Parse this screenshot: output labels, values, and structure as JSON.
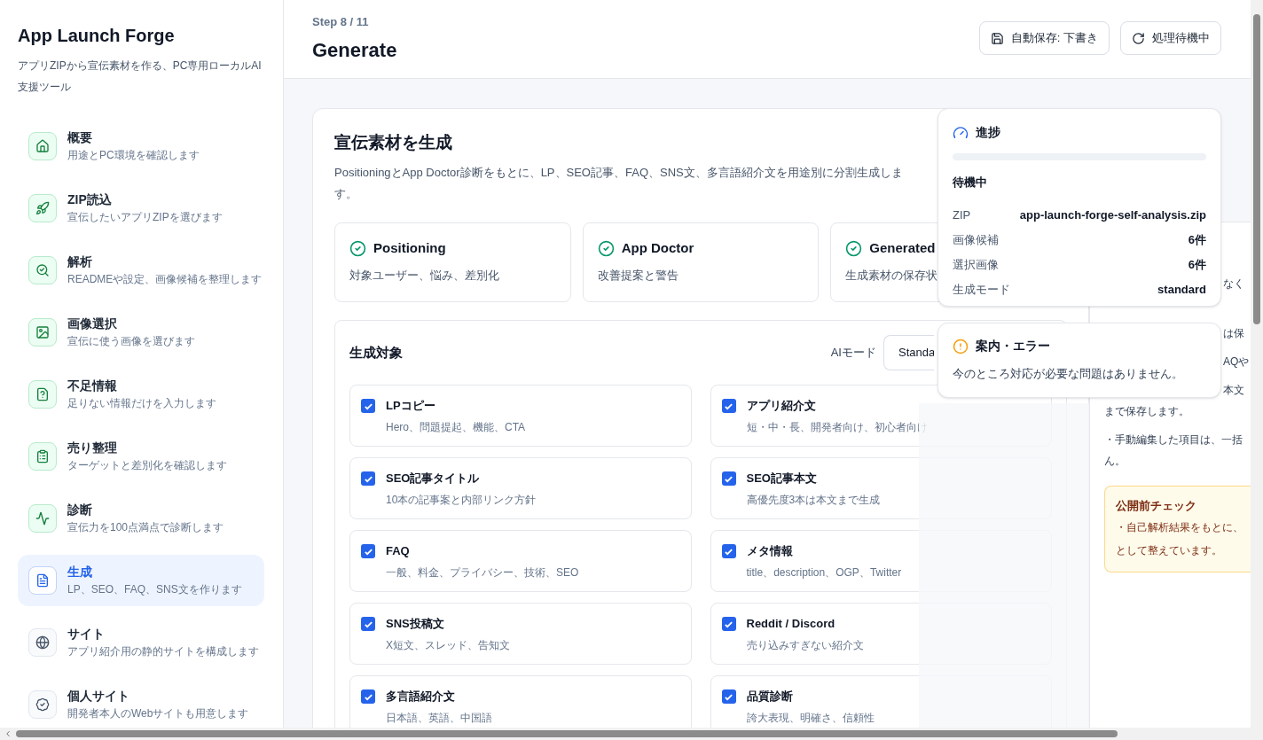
{
  "sidebar": {
    "title": "App Launch Forge",
    "subtitle": "アプリZIPから宣伝素材を作る、PC専用ローカルAI支援ツール",
    "items": [
      {
        "label": "概要",
        "description": "用途とPC環境を確認します",
        "completed": true,
        "selected": false
      },
      {
        "label": "ZIP読込",
        "description": "宣伝したいアプリZIPを選びます",
        "completed": true,
        "selected": false
      },
      {
        "label": "解析",
        "description": "READMEや設定、画像候補を整理します",
        "completed": true,
        "selected": false
      },
      {
        "label": "画像選択",
        "description": "宣伝に使う画像を選びます",
        "completed": true,
        "selected": false
      },
      {
        "label": "不足情報",
        "description": "足りない情報だけを入力します",
        "completed": true,
        "selected": false
      },
      {
        "label": "売り整理",
        "description": "ターゲットと差別化を確認します",
        "completed": true,
        "selected": false
      },
      {
        "label": "診断",
        "description": "宣伝力を100点満点で診断します",
        "completed": true,
        "selected": false
      },
      {
        "label": "生成",
        "description": "LP、SEO、FAQ、SNS文を作ります",
        "completed": false,
        "selected": true
      },
      {
        "label": "サイト",
        "description": "アプリ紹介用の静的サイトを構成します",
        "completed": false,
        "selected": false
      },
      {
        "label": "個人サイト",
        "description": "開発者本人のWebサイトも用意します",
        "completed": false,
        "selected": false
      }
    ]
  },
  "header": {
    "step": "Step 8 / 11",
    "title": "Generate",
    "buttons": [
      {
        "label": "自動保存: 下書き"
      },
      {
        "label": "処理待機中"
      }
    ]
  },
  "main": {
    "title": "宣伝素材を生成",
    "description": "PositioningとApp Doctor診断をもとに、LP、SEO記事、FAQ、SNS文、多言語紹介文を用途別に分割生成します。",
    "features": [
      {
        "title": "Positioning",
        "description": "対象ユーザー、悩み、差別化",
        "done": true
      },
      {
        "title": "App Doctor",
        "description": "改善提案と警告",
        "done": true
      },
      {
        "title": "Generated",
        "description": "生成素材の保存状",
        "done": true
      }
    ],
    "targets": {
      "title": "生成対象",
      "ai_mode_label": "AIモード",
      "ai_mode_value": "Standa",
      "items": [
        {
          "label": "LPコピー",
          "description": "Hero、問題提起、機能、CTA",
          "checked": true
        },
        {
          "label": "アプリ紹介文",
          "description": "短・中・長、開発者向け、初心者向け",
          "checked": true
        },
        {
          "label": "SEO記事タイトル",
          "description": "10本の記事案と内部リンク方針",
          "checked": true
        },
        {
          "label": "SEO記事本文",
          "description": "高優先度3本は本文まで生成",
          "checked": true
        },
        {
          "label": "FAQ",
          "description": "一般、料金、プライバシー、技術、SEO",
          "checked": true
        },
        {
          "label": "メタ情報",
          "description": "title、description、OGP、Twitter",
          "checked": true
        },
        {
          "label": "SNS投稿文",
          "description": "X短文、スレッド、告知文",
          "checked": true
        },
        {
          "label": "Reddit / Discord",
          "description": "売り込みすぎない紹介文",
          "checked": true
        },
        {
          "label": "多言語紹介文",
          "description": "日本語、英語、中国語",
          "checked": true
        },
        {
          "label": "品質診断",
          "description": "誇大表現、明確さ、信頼性",
          "checked": true
        }
      ]
    }
  },
  "notes": {
    "paragraphs": [
      {
        "lines": [
          {
            "kind": "fragment",
            "text": "なく"
          }
        ]
      },
      {
        "lines": [
          {
            "kind": "fragment",
            "text": "は保"
          }
        ]
      },
      {
        "lines": [
          {
            "kind": "fragment",
            "text": "AQや"
          }
        ]
      },
      {
        "lines": [
          {
            "kind": "fragment",
            "text": "本文"
          },
          {
            "kind": "line",
            "text": "まで保存します。"
          }
        ]
      },
      {
        "lines": [
          {
            "kind": "line",
            "text": "・手動編集した項目は、一括"
          },
          {
            "kind": "line",
            "text": "ん。"
          }
        ]
      }
    ],
    "check": {
      "title": "公開前チェック",
      "lines": [
        "・自己解析結果をもとに、",
        "として整えています。"
      ]
    }
  },
  "progress": {
    "title": "進捗",
    "level": 0,
    "status": "待機中",
    "rows": [
      {
        "label": "ZIP",
        "value": "app-launch-forge-self-analysis.zip"
      },
      {
        "label": "画像候補",
        "value": "6件"
      },
      {
        "label": "選択画像",
        "value": "6件"
      },
      {
        "label": "生成モード",
        "value": "standard"
      }
    ]
  },
  "alert": {
    "title": "案内・エラー",
    "message": "今のところ対応が必要な問題はありません。"
  }
}
